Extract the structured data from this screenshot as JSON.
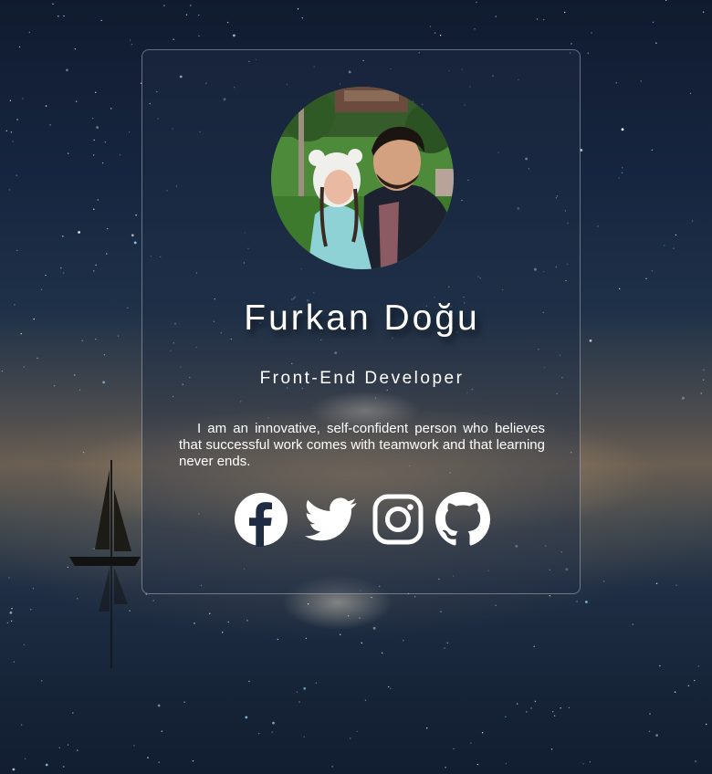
{
  "profile": {
    "name": "Furkan Doğu",
    "role": "Front-End Developer",
    "bio": "I am an innovative, self-confident person who believes that successful work comes with teamwork and that learning never ends."
  },
  "socials": [
    {
      "icon": "facebook-icon"
    },
    {
      "icon": "twitter-icon"
    },
    {
      "icon": "instagram-icon"
    },
    {
      "icon": "github-icon"
    }
  ],
  "colors": {
    "text": "#ffffff",
    "card_border": "#9aa6b5"
  }
}
